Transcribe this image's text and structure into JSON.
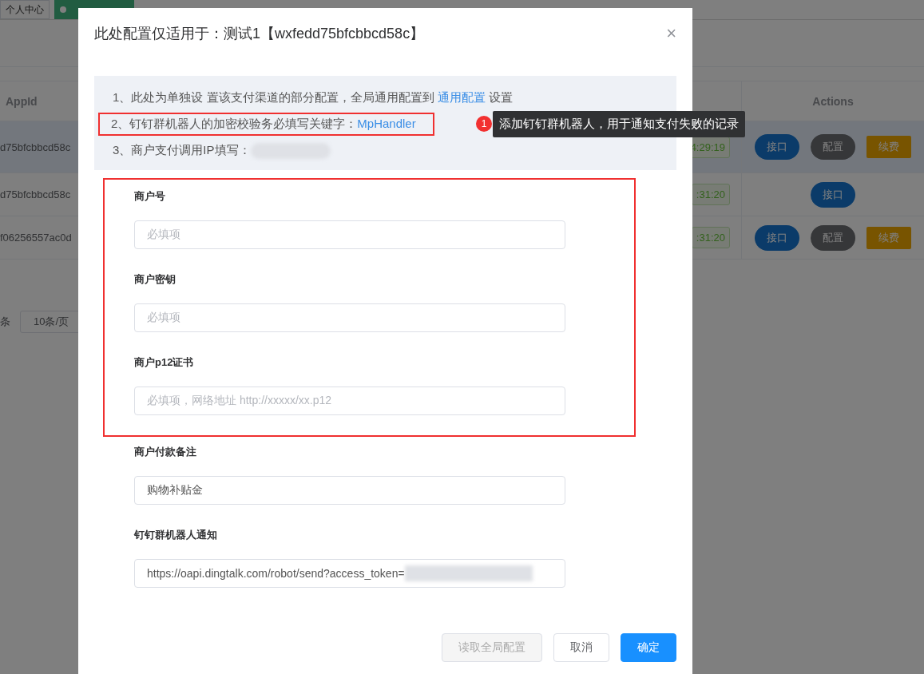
{
  "background": {
    "tabs": [
      {
        "label": "个人中心",
        "selected": false
      },
      {
        "selected": true
      }
    ],
    "table": {
      "columns": [
        "AppId",
        "Actions"
      ],
      "rows": [
        {
          "appid": "d75bfcbbcd58c",
          "time": "4:29:19",
          "selected": true,
          "actions": [
            {
              "label": "接口",
              "kind": "primary"
            },
            {
              "label": "配置",
              "kind": "gray"
            },
            {
              "label": "续费",
              "kind": "warning"
            }
          ]
        },
        {
          "appid": "d75bfcbbcd58c",
          "time": ":31:20",
          "selected": false,
          "actions": [
            {
              "label": "接口",
              "kind": "primary"
            }
          ]
        },
        {
          "appid": "f06256557ac0d",
          "time": ":31:20",
          "selected": false,
          "actions": [
            {
              "label": "接口",
              "kind": "primary"
            },
            {
              "label": "配置",
              "kind": "gray"
            },
            {
              "label": "续费",
              "kind": "warning"
            }
          ]
        }
      ]
    },
    "pagination": {
      "total_suffix": "条",
      "page_size": "10条/页"
    }
  },
  "modal": {
    "title": "此处配置仅适用于：测试1【wxfedd75bfcbbcd58c】",
    "close": "×",
    "notes": [
      {
        "parts": [
          {
            "kind": "text",
            "text": "1、此处为单独设 置该支付渠道的部分配置，全局通用配置到 "
          },
          {
            "kind": "link",
            "text": "通用配置"
          },
          {
            "kind": "text",
            "text": " 设置"
          }
        ],
        "highlighted": false,
        "redacted": false
      },
      {
        "parts": [
          {
            "kind": "text",
            "text": "2、钉钉群机器人的加密校验务必填写关键字："
          },
          {
            "kind": "link",
            "text": "MpHandler"
          }
        ],
        "highlighted": true,
        "redacted": false
      },
      {
        "parts": [
          {
            "kind": "text",
            "text": "3、商户支付调用IP填写："
          }
        ],
        "highlighted": false,
        "redacted": true
      }
    ],
    "annotation": {
      "number": "1",
      "text": "添加钉钉群机器人，用于通知支付失败的记录"
    },
    "fields": [
      {
        "label": "商户号",
        "placeholder": "必填项",
        "highlighted": true
      },
      {
        "label": "商户密钥",
        "placeholder": "必填项",
        "highlighted": true
      },
      {
        "label": "商户p12证书",
        "placeholder": "必填项，网络地址 http://xxxxx/xx.p12",
        "highlighted": true
      },
      {
        "label": "商户付款备注",
        "value": "购物补贴金",
        "highlighted": false
      },
      {
        "label": "钉钉群机器人通知",
        "value": "https://oapi.dingtalk.com/robot/send?access_token=",
        "redacted": true,
        "highlighted": false
      }
    ],
    "buttons": [
      {
        "label": "读取全局配置",
        "kind": "default",
        "disabled": true
      },
      {
        "label": "取消",
        "kind": "default",
        "disabled": false
      },
      {
        "label": "确定",
        "kind": "primary",
        "disabled": false
      }
    ]
  }
}
